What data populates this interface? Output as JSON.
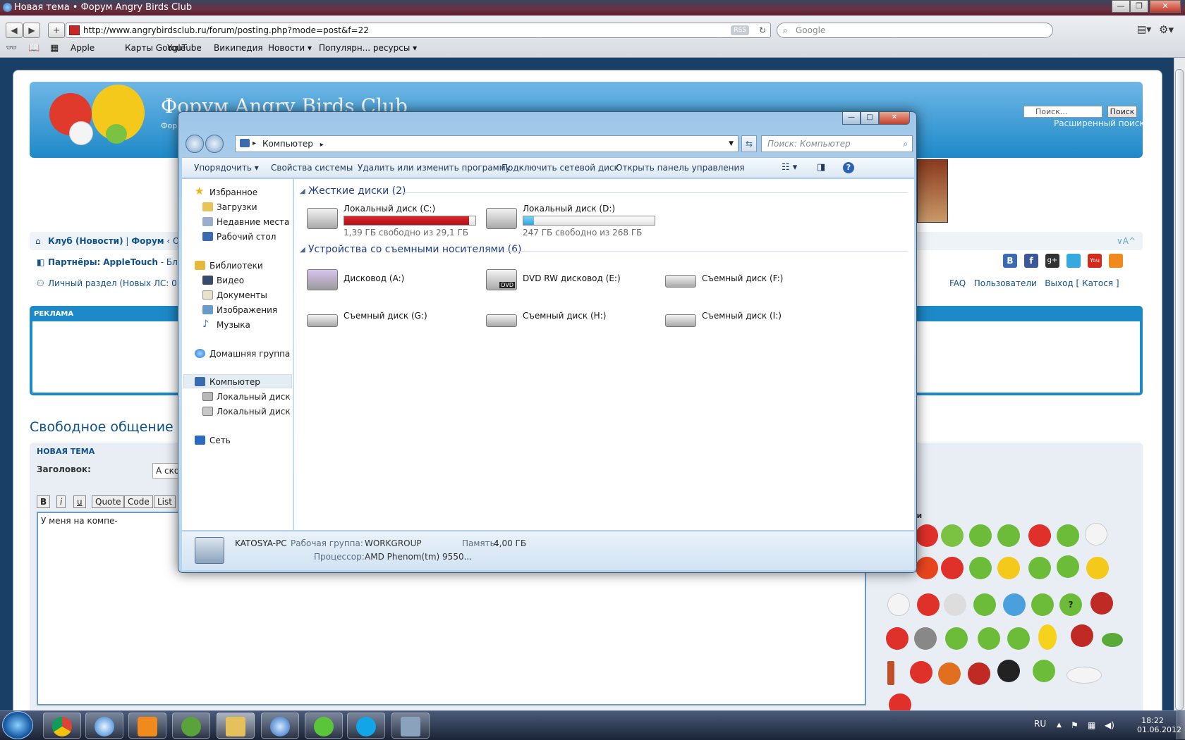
{
  "browser": {
    "title": "Новая тема • Форум Angry Birds Club",
    "url": "http://www.angrybirdsclub.ru/forum/posting.php?mode=post&f=22",
    "rss_label": "RSS",
    "search_placeholder": "Google",
    "back_glyph": "◀",
    "forward_glyph": "▶",
    "add_glyph": "+",
    "bookmarks": [
      "Apple",
      "Карты Google",
      "YouTube",
      "Википедия",
      "Новости ▾",
      "Популярн... ресурсы ▾"
    ]
  },
  "forum": {
    "title": "Форум Angry Birds Club",
    "subtitle": "Фор",
    "search_placeholder": "Поиск...",
    "search_button": "Поиск",
    "advanced_search": "Расширенный поиск",
    "nav1_a": "Клуб (Новости)",
    "nav1_b": "Форум",
    "nav1_c": "‹ О",
    "partners_label": "Партнёры:",
    "partners_value": "AppleTouch",
    "partners_tail": "- Бло",
    "private_section": "Личный раздел (Новых ЛС: 0)",
    "font_size_toggle": "∨A^",
    "right_links": [
      "FAQ",
      "Пользователи",
      "Выход",
      "[ Катося ]"
    ],
    "ads_label": "РЕКЛАМА",
    "section_title": "Свободное общение",
    "new_topic": "НОВАЯ ТЕМА",
    "subject_label": "Заголовок:",
    "subject_value": "А ско",
    "format_buttons": [
      "B",
      "i",
      "u",
      "Quote",
      "Code",
      "List"
    ],
    "message_text": "У меня на компе-",
    "smileys_label": "ки"
  },
  "explorer": {
    "window_buttons": [
      "—",
      "□",
      "✕"
    ],
    "breadcrumb": "Компьютер",
    "search_placeholder": "Поиск: Компьютер",
    "commands": [
      "Упорядочить ▾",
      "Свойства системы",
      "Удалить или изменить программу",
      "Подключить сетевой диск",
      "Открыть панель управления"
    ],
    "nav": {
      "favorites": "Избранное",
      "downloads": "Загрузки",
      "recent": "Недавние места",
      "desktop": "Рабочий стол",
      "libraries": "Библиотеки",
      "video": "Видео",
      "documents": "Документы",
      "pictures": "Изображения",
      "music": "Музыка",
      "homegroup": "Домашняя группа",
      "computer": "Компьютер",
      "disk_c": "Локальный диск (C",
      "disk_d": "Локальный диск (D",
      "network": "Сеть"
    },
    "groups": {
      "hard_disks": "Жесткие диски (2)",
      "removable": "Устройства со съемными носителями (6)"
    },
    "drives": {
      "c_name": "Локальный диск (C:)",
      "c_free": "1,39 ГБ свободно из 29,1 ГБ",
      "c_used_fraction": 0.952,
      "d_name": "Локальный диск (D:)",
      "d_free": "247 ГБ свободно из 268 ГБ",
      "d_used_fraction": 0.078,
      "a": "Дисковод (A:)",
      "e": "DVD RW дисковод (E:)",
      "f": "Съемный диск (F:)",
      "g": "Съемный диск (G:)",
      "h": "Съемный диск (H:)",
      "i": "Съемный диск (I:)",
      "dvd_badge": "DVD"
    },
    "details": {
      "pc_name": "KATOSYA-PC",
      "workgroup_label": "Рабочая группа:",
      "workgroup_value": "WORKGROUP",
      "memory_label": "Память:",
      "memory_value": "4,00 ГБ",
      "cpu_label": "Процессор:",
      "cpu_value": "AMD Phenom(tm) 9550..."
    }
  },
  "taskbar": {
    "lang": "RU",
    "time": "18:22",
    "date": "01.06.2012"
  },
  "colors": {
    "c_bar": "#e0242c",
    "d_bar": "#2ca6de",
    "forum_blue": "#1e89c8"
  }
}
